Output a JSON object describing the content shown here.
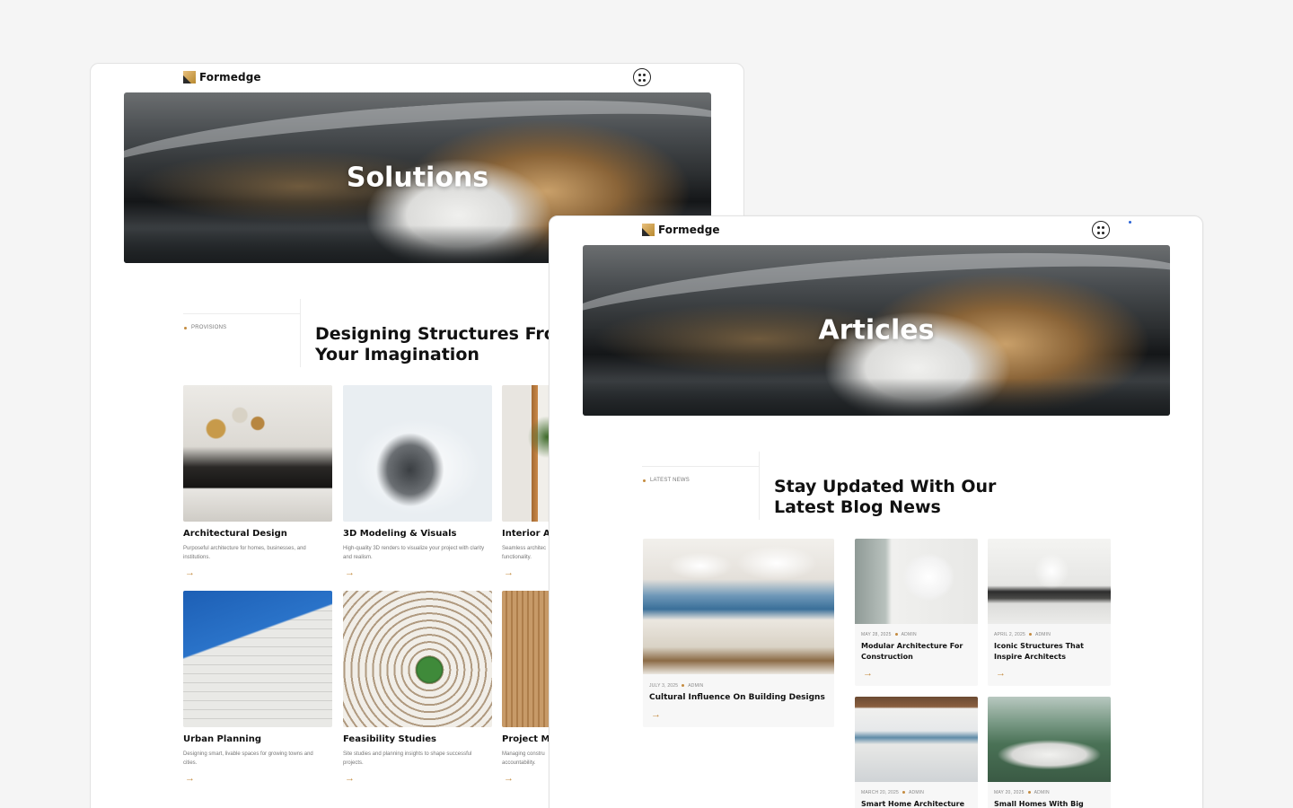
{
  "brand": {
    "name": "Formedge",
    "accent": "#c48b3f"
  },
  "solutions_page": {
    "hero_title": "Solutions",
    "tag": "PROVISIONS",
    "section_title_line1": "Designing Structures From",
    "section_title_line2": "Your Imagination",
    "services": [
      {
        "title": "Architectural Design",
        "desc": "Purposeful architecture for homes, businesses, and institutions.",
        "icon": "arrow-right-icon"
      },
      {
        "title": "3D Modeling & Visuals",
        "desc": "High-quality 3D renders to visualize your project with clarity and realism.",
        "icon": "arrow-right-icon"
      },
      {
        "title": "Interior Ar",
        "desc": "Seamless architec functionality.",
        "icon": "arrow-right-icon"
      },
      {
        "title": "Urban Planning",
        "desc": "Designing smart, livable spaces for growing towns and cities.",
        "icon": "arrow-right-icon"
      },
      {
        "title": "Feasibility Studies",
        "desc": "Site studies and planning insights to shape successful projects.",
        "icon": "arrow-right-icon"
      },
      {
        "title": "Project Ma",
        "desc": "Managing constru accountability.",
        "icon": "arrow-right-icon"
      }
    ]
  },
  "articles_page": {
    "hero_title": "Articles",
    "tag": "LATEST NEWS",
    "section_title_line1": "Stay Updated With Our",
    "section_title_line2": "Latest Blog News",
    "featured": {
      "date": "JULY 3, 2025",
      "author": "ADMIN",
      "title": "Cultural Influence On Building Designs"
    },
    "posts": [
      {
        "date": "MAY 28, 2025",
        "author": "ADMIN",
        "title_line1": "Modular Architecture For",
        "title_line2": "Construction"
      },
      {
        "date": "APRIL 2, 2025",
        "author": "ADMIN",
        "title_line1": "Iconic Structures That",
        "title_line2": "Inspire Architects"
      },
      {
        "date": "MARCH 20, 2025",
        "author": "ADMIN",
        "title_line1": "Smart Home Architecture",
        "title_line2": ""
      },
      {
        "date": "MAY 20, 2025",
        "author": "ADMIN",
        "title_line1": "Small Homes With Big",
        "title_line2": ""
      }
    ]
  },
  "arrow_glyph": "→"
}
